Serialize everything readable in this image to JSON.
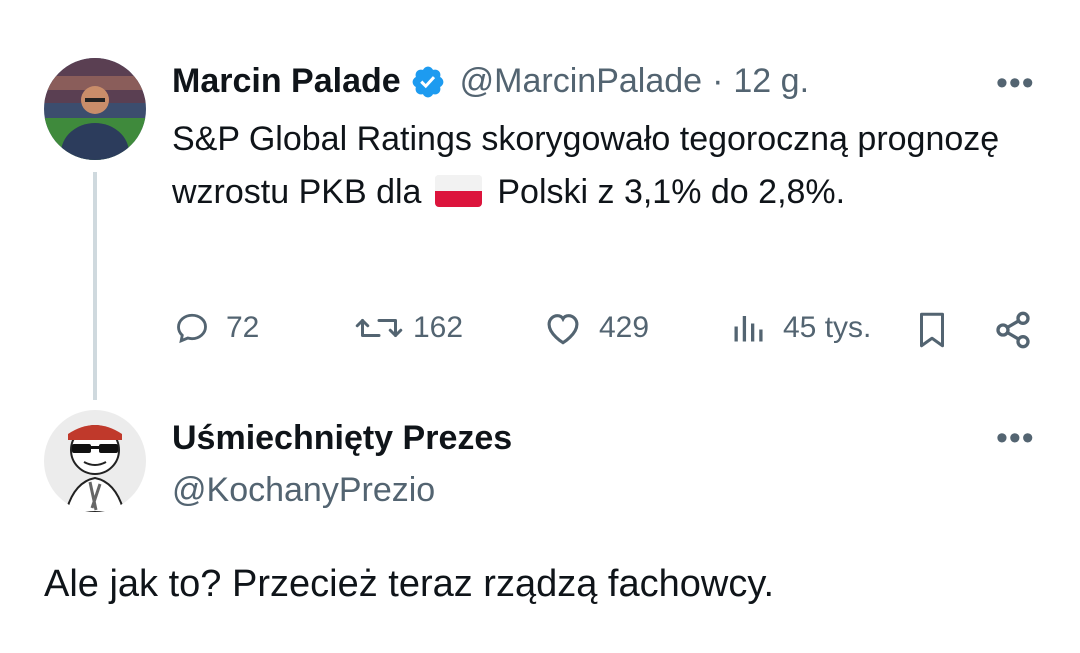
{
  "tweet": {
    "author_name": "Marcin Palade",
    "author_handle": "@MarcinPalade",
    "separator": "·",
    "time": "12 g.",
    "text_part1": "S&P Global Ratings skorygowało tegoroczną prognozę wzrostu PKB dla",
    "flag_icon": "poland-flag-icon",
    "text_part2": "Polski z 3,1% do 2,8%.",
    "more_label": "•••",
    "actions": {
      "replies": "72",
      "retweets": "162",
      "likes": "429",
      "views": "45 tys."
    }
  },
  "reply": {
    "author_name": "Uśmiechnięty Prezes",
    "author_handle": "@KochanyPrezio",
    "more_label": "•••",
    "text": "Ale jak to? Przecież teraz rządzą fachowcy."
  },
  "colors": {
    "verified_blue": "#1d9bf0",
    "muted": "#536471",
    "thread_line": "#cfd9de",
    "flag_red": "#dc143c"
  }
}
